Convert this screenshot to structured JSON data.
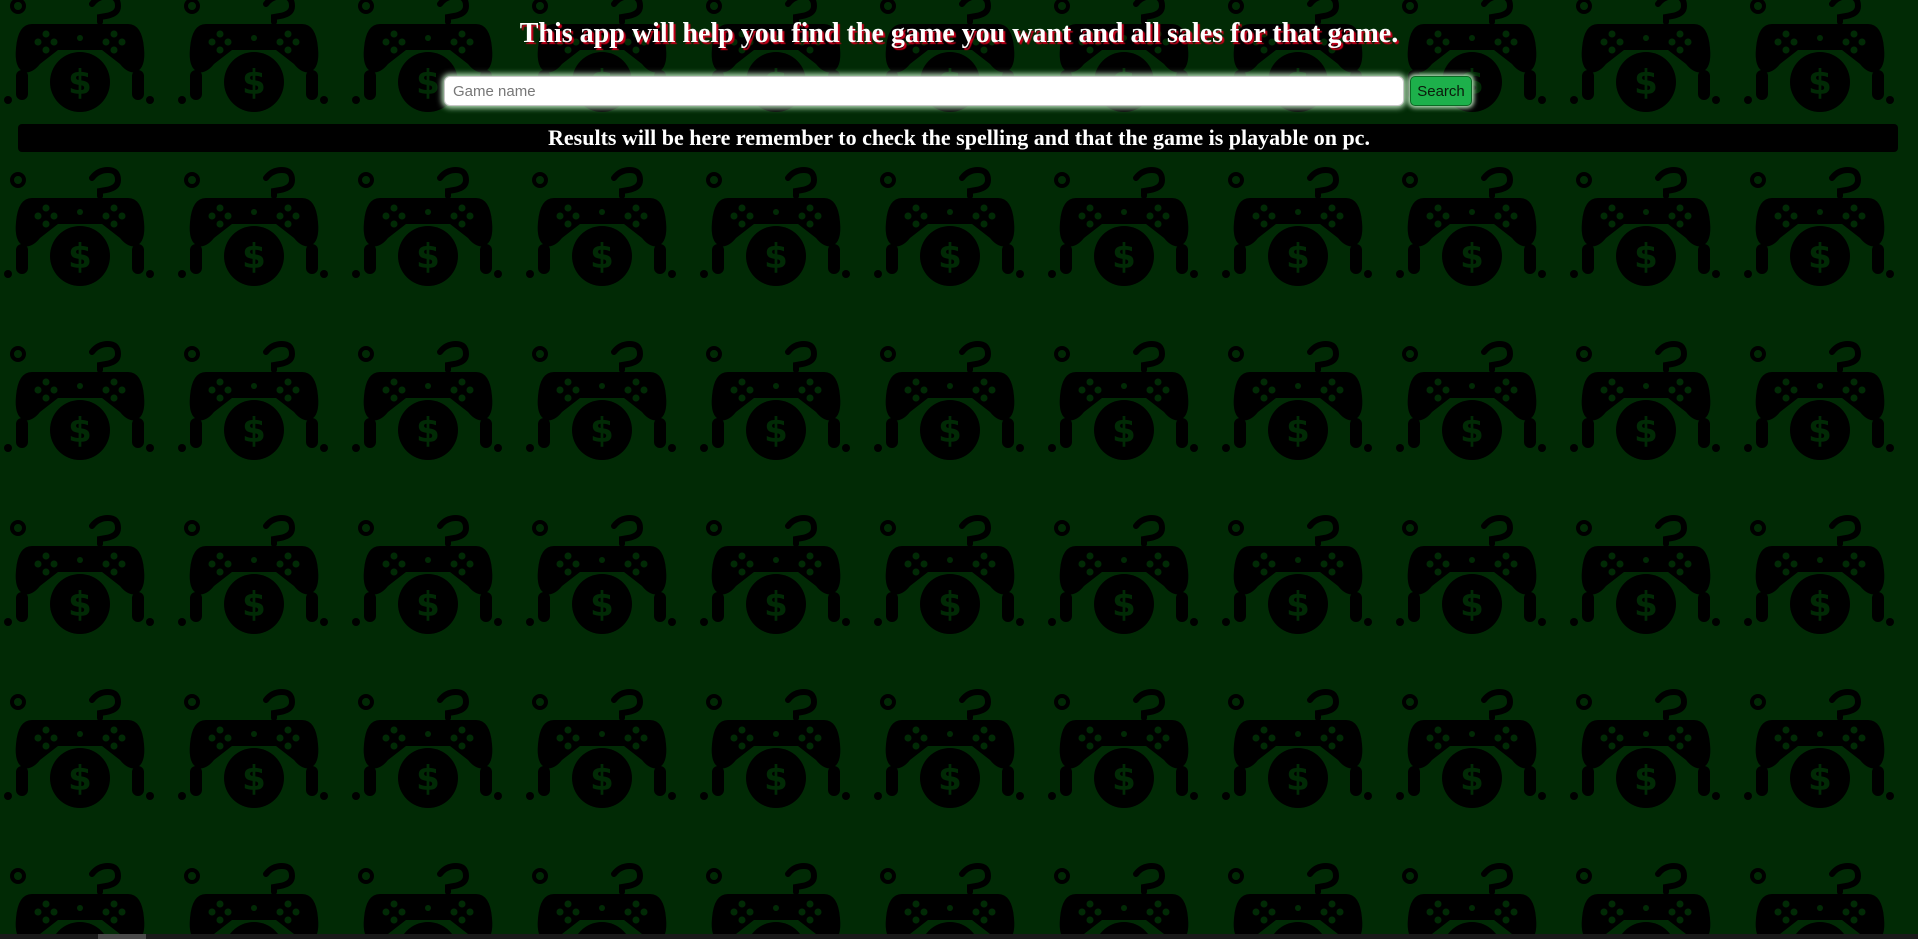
{
  "header": {
    "title": "This app will help you find the game you want and all sales for that game."
  },
  "search": {
    "placeholder": "Game name",
    "value": "",
    "button_label": "Search"
  },
  "results": {
    "message": "Results will be here remember to check the spelling and that the game is playable on pc."
  },
  "background": {
    "pattern_icons": [
      "gamepad-icon",
      "dollar-coin-icon",
      "question-mark-icon",
      "dot-icon"
    ]
  },
  "colors": {
    "background": "#012a05",
    "pattern_ink": "#000000",
    "title_shadow": "#c4001a",
    "button": "#1db04b"
  }
}
